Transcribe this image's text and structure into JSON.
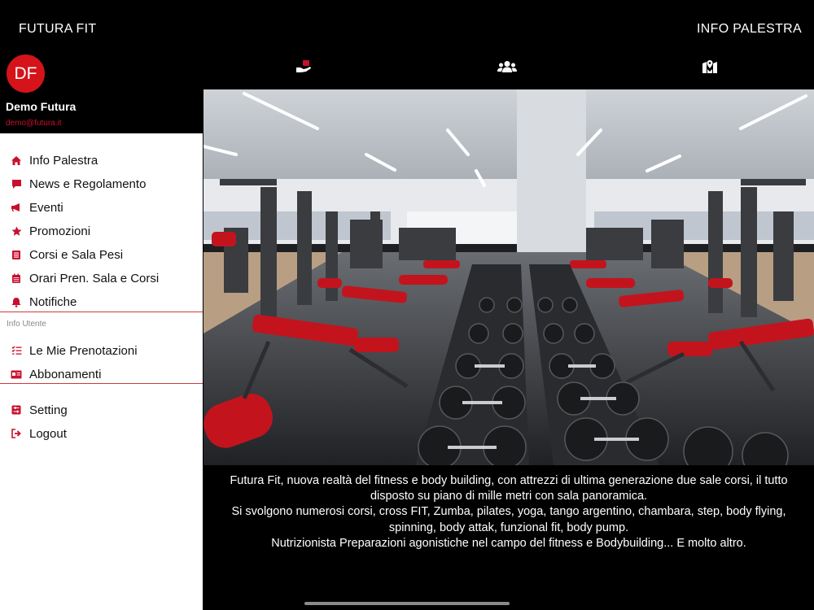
{
  "header": {
    "app_title": "FUTURA FIT",
    "page_title": "INFO PALESTRA"
  },
  "user": {
    "initials": "DF",
    "name": "Demo Futura",
    "email": "demo@futura.it"
  },
  "menu": [
    {
      "label": "Info Palestra",
      "icon": "home-icon"
    },
    {
      "label": "News e Regolamento",
      "icon": "comment-icon"
    },
    {
      "label": "Eventi",
      "icon": "megaphone-icon"
    },
    {
      "label": "Promozioni",
      "icon": "star-icon"
    },
    {
      "label": "Corsi e Sala Pesi",
      "icon": "list-book-icon"
    },
    {
      "label": "Orari Pren. Sala e Corsi",
      "icon": "calendar-icon"
    },
    {
      "label": "Notifiche",
      "icon": "bell-icon"
    }
  ],
  "user_section": {
    "label": "Info Utente",
    "items": [
      {
        "label": "Le Mie Prenotazioni",
        "icon": "tasks-icon"
      },
      {
        "label": "Abbonamenti",
        "icon": "card-icon"
      }
    ]
  },
  "bottom_menu": [
    {
      "label": "Setting",
      "icon": "settings-icon"
    },
    {
      "label": "Logout",
      "icon": "logout-icon"
    }
  ],
  "tabs": [
    {
      "icon": "hand-holding-icon"
    },
    {
      "icon": "users-icon"
    },
    {
      "icon": "map-marker-icon"
    }
  ],
  "colors": {
    "accent": "#d4131b",
    "background": "#000000",
    "drawer": "#ffffff"
  },
  "description": {
    "lines": [
      "Futura Fit, nuova realtà del fitness e body building, con attrezzi di ultima generazione due sale corsi, il tutto",
      "disposto su piano di mille metri con sala panoramica.",
      "Si svolgono numerosi corsi, cross FIT, Zumba, pilates, yoga, tango argentino, chambara, step, body flying,",
      "spinning, body attak, funzional fit, body pump.",
      "Nutrizionista Preparazioni agonistiche nel campo del fitness e Bodybuilding... E molto altro."
    ]
  }
}
